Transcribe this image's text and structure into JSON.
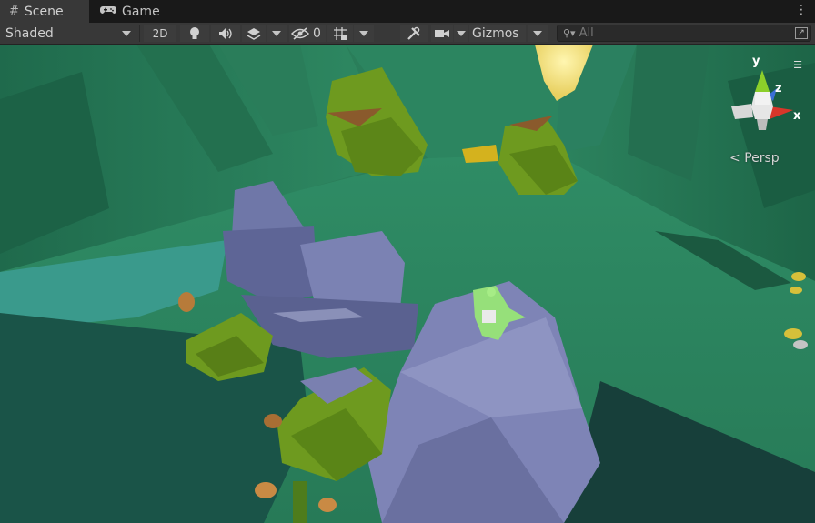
{
  "tabs": [
    {
      "label": "Scene",
      "icon": "grid-icon",
      "active": true
    },
    {
      "label": "Game",
      "icon": "gamepad-icon",
      "active": false
    }
  ],
  "toolbar": {
    "draw_mode": "Shaded",
    "mode_2d": "2D",
    "hidden_count": "0",
    "gizmos_label": "Gizmos",
    "search_placeholder": "All"
  },
  "viewport": {
    "projection_label": "Persp",
    "axes": {
      "x": "x",
      "y": "y",
      "z": "z"
    },
    "colors": {
      "x_axis": "#d8362a",
      "y_axis": "#8ccf2a",
      "z_axis": "#3b6fd6"
    }
  }
}
